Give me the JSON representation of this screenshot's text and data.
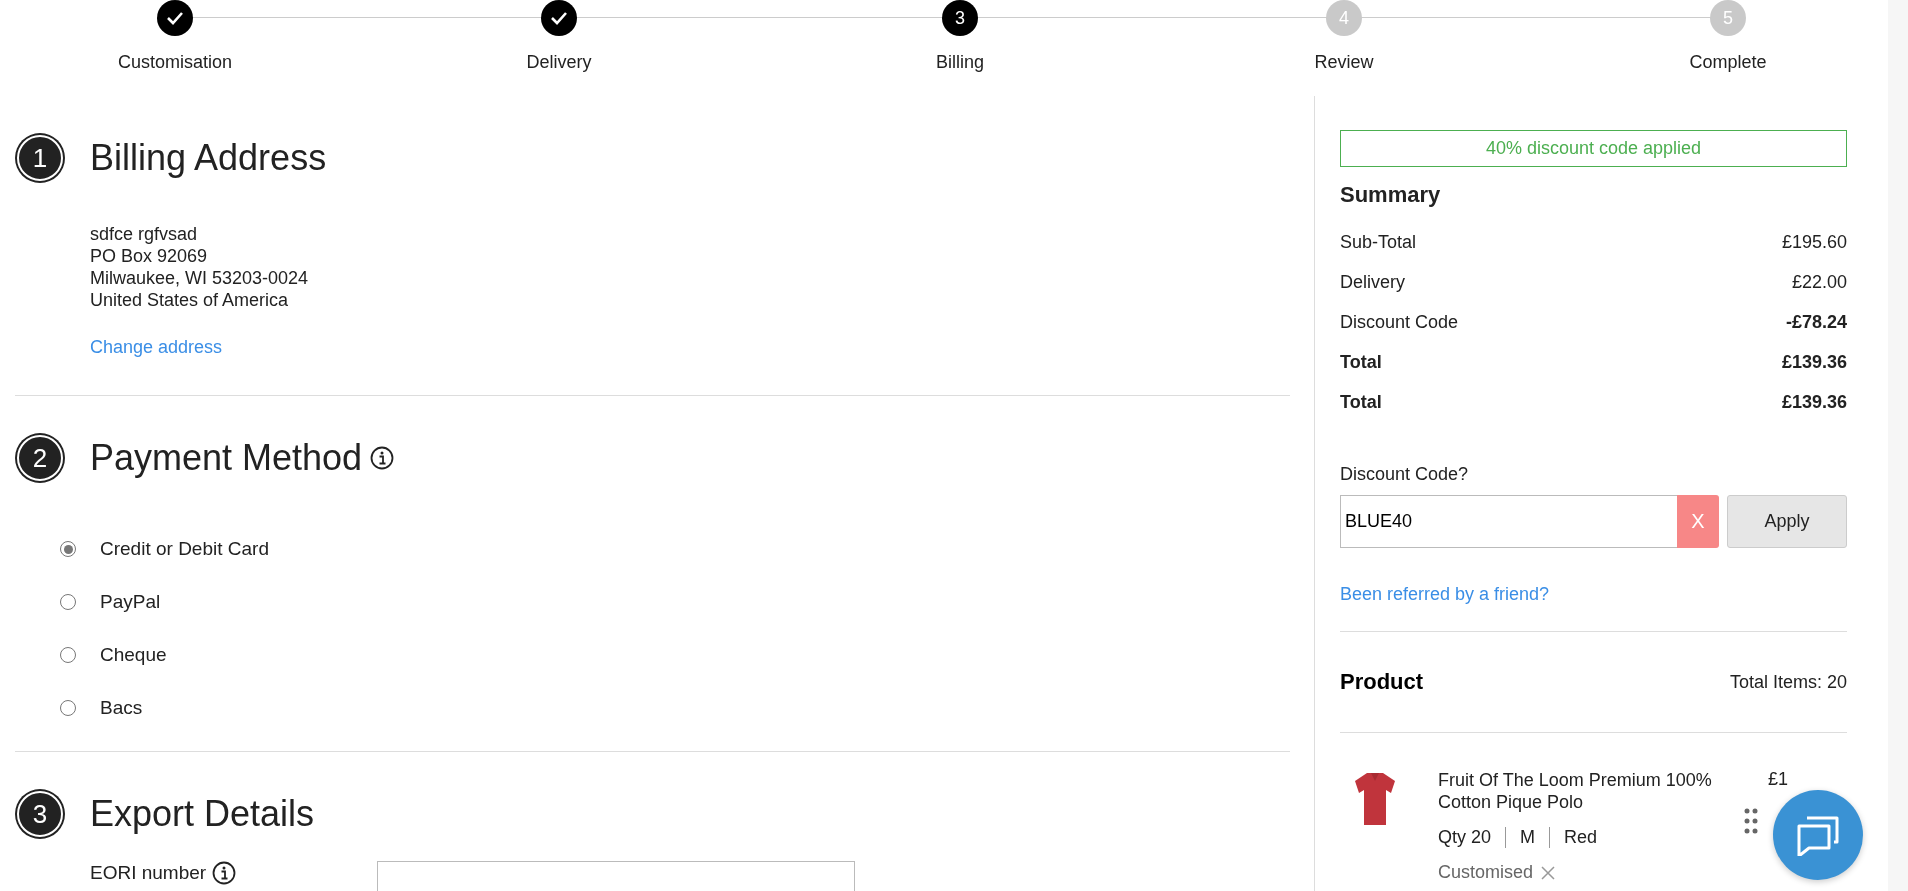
{
  "steps": [
    {
      "label": "Customisation",
      "completed": true,
      "current": false
    },
    {
      "label": "Delivery",
      "completed": true,
      "current": false
    },
    {
      "label": "Billing",
      "completed": false,
      "current": true,
      "number": "3"
    },
    {
      "label": "Review",
      "completed": false,
      "current": false,
      "number": "4"
    },
    {
      "label": "Complete",
      "completed": false,
      "current": false,
      "number": "5"
    }
  ],
  "billing_address": {
    "number": "1",
    "title": "Billing Address",
    "address_lines": [
      "sdfce rgfvsad",
      "PO Box 92069",
      "Milwaukee, WI 53203-0024",
      "United States of America"
    ],
    "change_link": "Change address"
  },
  "payment_method": {
    "number": "2",
    "title": "Payment Method",
    "options": [
      {
        "label": "Credit or Debit Card",
        "selected": true
      },
      {
        "label": "PayPal",
        "selected": false
      },
      {
        "label": "Cheque",
        "selected": false
      },
      {
        "label": "Bacs",
        "selected": false
      }
    ]
  },
  "export_details": {
    "number": "3",
    "title": "Export Details",
    "fields": [
      {
        "label": "EORI number"
      }
    ]
  },
  "summary": {
    "notice": "40% discount code applied",
    "title": "Summary",
    "rows": [
      {
        "label": "Sub-Total",
        "value": "£195.60",
        "bold_label": false,
        "bold_value": false
      },
      {
        "label": "Delivery",
        "value": "£22.00",
        "bold_label": false,
        "bold_value": false
      },
      {
        "label": "Discount Code",
        "value": "-£78.24",
        "bold_label": false,
        "bold_value": true
      },
      {
        "label": "Total",
        "value": "£139.36",
        "bold_label": true,
        "bold_value": true
      },
      {
        "label": "Total",
        "value": "£139.36",
        "bold_label": true,
        "bold_value": true
      }
    ]
  },
  "discount": {
    "label": "Discount Code?",
    "value": "BLUE40",
    "clear": "X",
    "apply": "Apply"
  },
  "referral_link": "Been referred by a friend?",
  "products": {
    "title": "Product",
    "total_items": "Total Items: 20",
    "items": [
      {
        "name": "Fruit Of The Loom Premium 100% Cotton Pique Polo",
        "price": "£1",
        "qty": "Qty 20",
        "size": "M",
        "colour": "Red",
        "tag": "Customised"
      }
    ]
  }
}
